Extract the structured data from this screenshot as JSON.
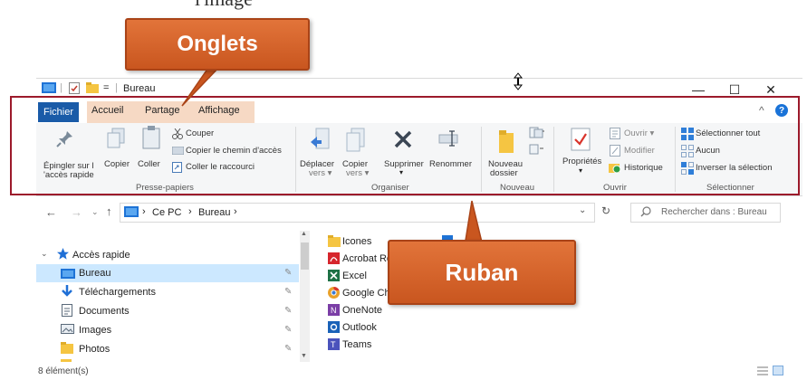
{
  "annotations": {
    "onglets": "Onglets",
    "ruban": "Ruban"
  },
  "top_fragment": "l'image",
  "window": {
    "title": "Bureau",
    "title_separator": "|",
    "qat_dropdown": "=",
    "buttons": {
      "minimize": "—",
      "maximize": "☐",
      "close": "✕"
    }
  },
  "tabs": [
    "Fichier",
    "Accueil",
    "Partage",
    "Affichage"
  ],
  "ribbon": {
    "collapse_glyph": "^",
    "help_glyph": "?",
    "groups": {
      "presse_papiers": {
        "label": "Presse-papiers",
        "pin": [
          "Épingler sur l",
          "'accès rapide"
        ],
        "copy": "Copier",
        "paste": "Coller",
        "cut": "Couper",
        "copy_path": "Copier le chemin d'accès",
        "paste_shortcut": "Coller le raccourci"
      },
      "organiser": {
        "label": "Organiser",
        "move": [
          "Déplacer",
          "vers ▾"
        ],
        "copy_to": [
          "Copier",
          "vers ▾"
        ],
        "delete": "Supprimer",
        "rename": "Renommer"
      },
      "nouveau": {
        "label": "Nouveau",
        "new_folder": [
          "Nouveau",
          "dossier"
        ]
      },
      "ouvrir": {
        "label": "Ouvrir",
        "properties": "Propriétés",
        "open": "Ouvrir ▾",
        "edit": "Modifier",
        "history": "Historique"
      },
      "selectionner": {
        "label": "Sélectionner",
        "select_all": "Sélectionner tout",
        "select_none": "Aucun",
        "invert": "Inverser la sélection"
      }
    }
  },
  "address": {
    "crumbs": [
      "Ce PC",
      "Bureau"
    ],
    "separator": "›",
    "search_placeholder": "Rechercher dans : Bureau"
  },
  "nav": {
    "quick_access": "Accès rapide",
    "items": [
      "Bureau",
      "Téléchargements",
      "Documents",
      "Images",
      "Photos"
    ]
  },
  "files": [
    "Icones",
    "Acrobat Re",
    "Excel",
    "Google Ch",
    "OneNote",
    "Outlook",
    "Teams"
  ],
  "status": {
    "count": "8 élément(s)"
  },
  "colors": {
    "accent": "#1a5ba8",
    "selection": "#cce8ff",
    "callout": "#d8642a",
    "annotation_box": "#9c1a2b"
  }
}
